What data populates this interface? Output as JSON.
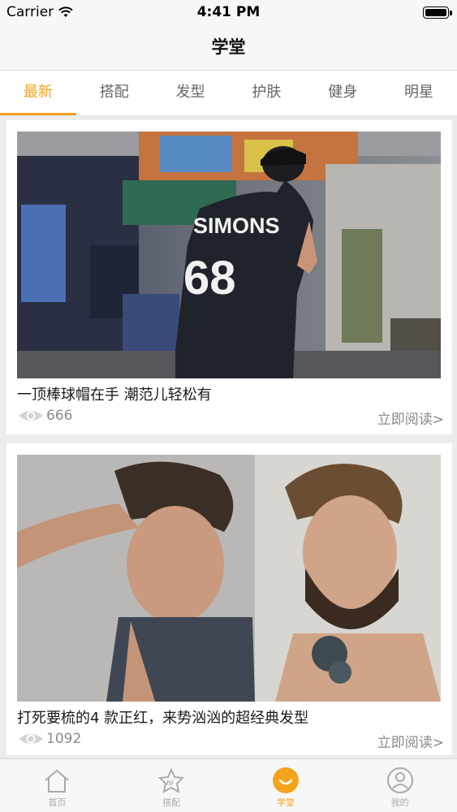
{
  "status_bar": {
    "carrier": "Carrier",
    "time": "4:41 PM"
  },
  "nav": {
    "title": "学堂"
  },
  "tabs": [
    {
      "label": "最新",
      "active": true
    },
    {
      "label": "搭配",
      "active": false
    },
    {
      "label": "发型",
      "active": false
    },
    {
      "label": "护肤",
      "active": false
    },
    {
      "label": "健身",
      "active": false
    },
    {
      "label": "明星",
      "active": false
    }
  ],
  "articles": [
    {
      "title": "一顶棒球帽在手 潮范儿轻松有",
      "views": "666",
      "read_label": "立即阅读>",
      "jersey_name": "SIMONS",
      "jersey_number": "68"
    },
    {
      "title": "打死要梳的4 款正红，来势汹汹的超经典发型",
      "views": "1092",
      "read_label": "立即阅读>"
    }
  ],
  "tab_bar": [
    {
      "label": "首页",
      "icon": "home-icon",
      "active": false
    },
    {
      "label": "搭配",
      "icon": "star-hi-icon",
      "active": false
    },
    {
      "label": "学堂",
      "icon": "smile-icon",
      "active": true
    },
    {
      "label": "我的",
      "icon": "user-icon",
      "active": false
    }
  ],
  "colors": {
    "accent": "#f4a31b",
    "text_secondary": "#8a8a8a",
    "background": "#ececec"
  }
}
